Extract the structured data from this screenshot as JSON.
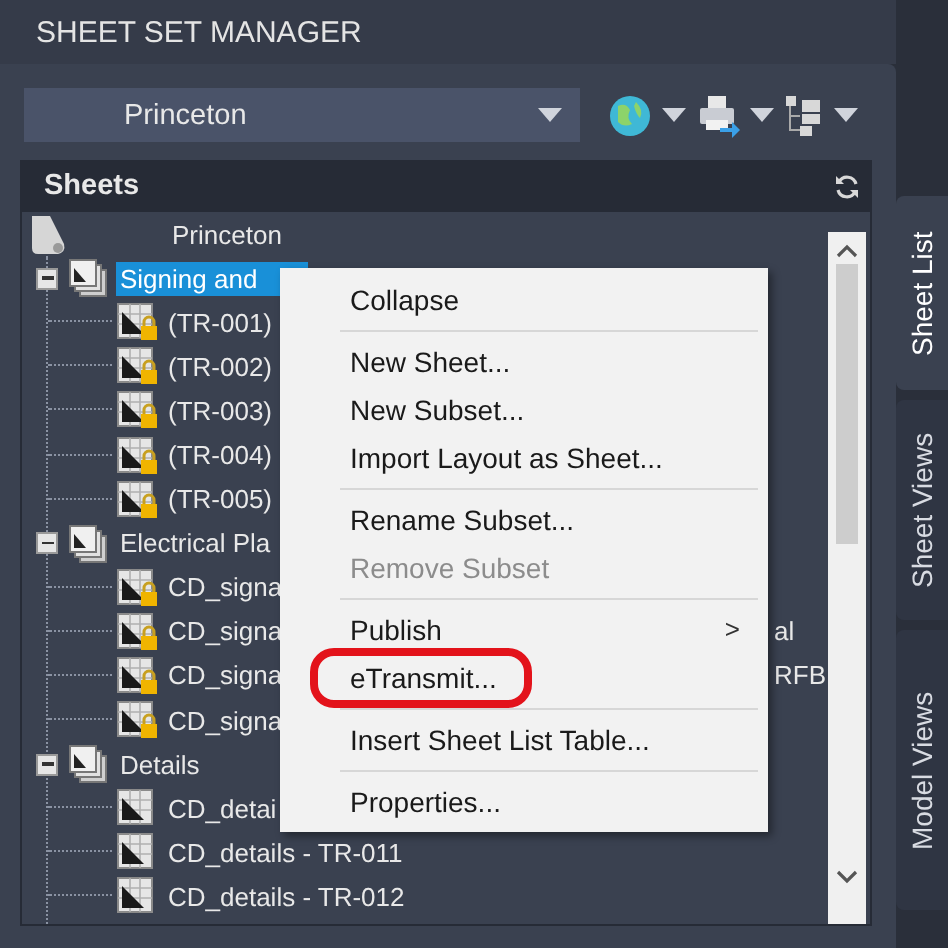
{
  "panel": {
    "title": "SHEET SET MANAGER"
  },
  "sheet_set_dropdown": {
    "value": "Princeton"
  },
  "toolbar": [
    {
      "kind": "globe"
    },
    {
      "kind": "printer"
    },
    {
      "kind": "views"
    }
  ],
  "side_tabs": [
    {
      "label": "Sheet List",
      "selected": true
    },
    {
      "label": "Sheet Views",
      "selected": false
    },
    {
      "label": "Model Views",
      "selected": false
    }
  ],
  "sheets": {
    "header": "Sheets",
    "tree": [
      {
        "kind": "sheet_set",
        "label": "Princeton",
        "selected": false,
        "children": [
          {
            "kind": "subset",
            "label": "Signing and",
            "selected": true,
            "expanded": true,
            "children": [
              {
                "kind": "sheet",
                "label": "(TR-001)",
                "locked": true,
                "selected": false
              },
              {
                "kind": "sheet",
                "label": "(TR-002)",
                "locked": true,
                "selected": false
              },
              {
                "kind": "sheet",
                "label": "(TR-003)",
                "locked": true,
                "selected": false
              },
              {
                "kind": "sheet",
                "label": "(TR-004)",
                "locked": true,
                "selected": false
              },
              {
                "kind": "sheet",
                "label": "(TR-005)",
                "locked": true,
                "selected": false
              }
            ]
          },
          {
            "kind": "subset",
            "label": "Electrical Pla",
            "selected": false,
            "expanded": true,
            "children": [
              {
                "kind": "sheet",
                "label": "CD_signa",
                "locked": true,
                "selected": false
              },
              {
                "kind": "sheet",
                "label": "CD_signa",
                "tail": "al",
                "locked": true,
                "selected": false
              },
              {
                "kind": "sheet",
                "label": "CD_signa",
                "tail": "RFB",
                "locked": true,
                "selected": false
              },
              {
                "kind": "sheet",
                "label": "CD_signa",
                "locked": true,
                "selected": false
              }
            ]
          },
          {
            "kind": "subset",
            "label": "Details",
            "selected": false,
            "expanded": true,
            "children": [
              {
                "kind": "sheet",
                "label": "CD_detai",
                "locked": false,
                "selected": false
              },
              {
                "kind": "sheet",
                "label": "CD_details - TR-011",
                "locked": false,
                "selected": false
              },
              {
                "kind": "sheet",
                "label": "CD_details - TR-012",
                "locked": false,
                "selected": false
              }
            ]
          }
        ]
      }
    ]
  },
  "context_menu": {
    "items": [
      {
        "kind": "item",
        "label": "Collapse",
        "disabled": false
      },
      {
        "kind": "separator"
      },
      {
        "kind": "item",
        "label": "New Sheet...",
        "disabled": false
      },
      {
        "kind": "item",
        "label": "New Subset...",
        "disabled": false
      },
      {
        "kind": "item",
        "label": "Import Layout as Sheet...",
        "disabled": false
      },
      {
        "kind": "separator"
      },
      {
        "kind": "item",
        "label": "Rename Subset...",
        "disabled": false
      },
      {
        "kind": "item",
        "label": "Remove Subset",
        "disabled": true
      },
      {
        "kind": "separator"
      },
      {
        "kind": "item",
        "label": "Publish",
        "disabled": false,
        "submenu": true,
        "arrow": ">"
      },
      {
        "kind": "item",
        "label": "eTransmit...",
        "disabled": false,
        "circled": true
      },
      {
        "kind": "separator"
      },
      {
        "kind": "item",
        "label": "Insert Sheet List Table...",
        "disabled": false
      },
      {
        "kind": "separator"
      },
      {
        "kind": "item",
        "label": "Properties...",
        "disabled": false
      }
    ]
  }
}
